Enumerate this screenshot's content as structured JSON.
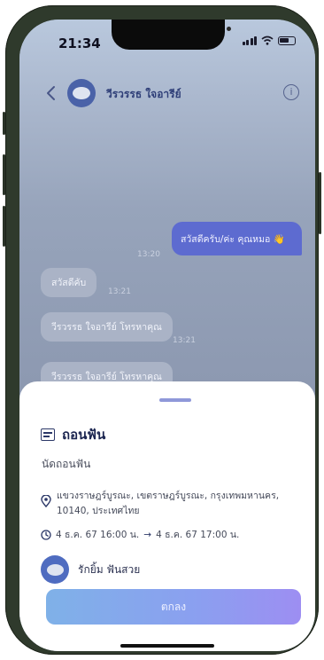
{
  "status": {
    "time": "21:34"
  },
  "header": {
    "contact_name": "วีรวรรธ ใจอารีย์",
    "info_glyph": "i"
  },
  "messages": [
    {
      "type": "outgoing",
      "text": "สวัสดีครับ/ค่ะ คุณหมอ 👋",
      "time": "13:20"
    },
    {
      "type": "incoming",
      "text": "สวัสดีคับ",
      "time": "13:21"
    },
    {
      "type": "incoming",
      "text": "วีรวรรธ ใจอารีย์ โทรหาคุณ",
      "time": "13:21"
    },
    {
      "type": "incoming",
      "text": "วีรวรรธ ใจอารีย์ โทรหาคุณ",
      "time": ""
    }
  ],
  "sheet": {
    "title": "ถอนฟัน",
    "subtitle": "นัดถอนฟัน",
    "location_line1": "แขวงราษฎร์บูรณะ, เขตราษฎร์บูรณะ, กรุงเทพมหานคร,",
    "location_line2": "10140, ประเทศไทย",
    "start": "4 ธ.ค. 67 16:00 น.",
    "arrow": "→",
    "end": "4 ธ.ค. 67 17:00 น.",
    "doctor_name": "รักยิ้ม ฟันสวย",
    "ok_label": "ตกลง"
  },
  "colors": {
    "accent": "#5d6bd0",
    "title": "#1b2550"
  }
}
